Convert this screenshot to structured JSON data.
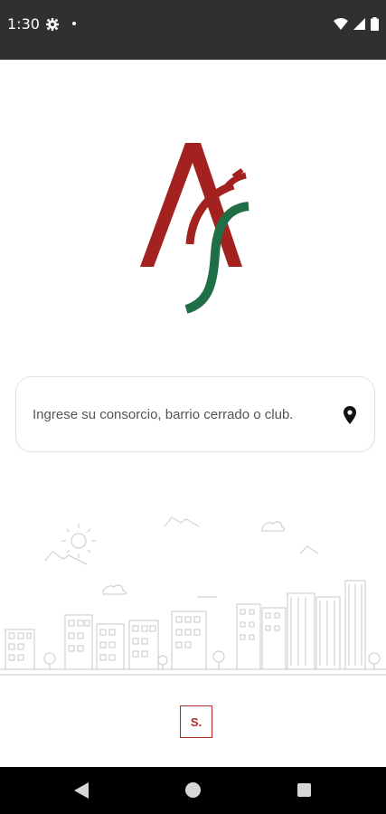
{
  "status_bar": {
    "time": "1:30",
    "icons": [
      "settings-icon",
      "notification-dot",
      "wifi-icon",
      "cell-signal-icon",
      "battery-icon"
    ]
  },
  "logo": {
    "name": "asf-logo",
    "colors": {
      "red": "#a3221f",
      "green": "#1f6e45"
    }
  },
  "search": {
    "placeholder": "Ingrese su consorcio, barrio cerrado o club.",
    "icon": "location-pin-icon"
  },
  "illustration": {
    "name": "city-skyline-illustration"
  },
  "footer": {
    "badge_label": "S.",
    "badge_color": "#b32a2a"
  },
  "nav_bar": {
    "buttons": [
      "back-icon",
      "home-icon",
      "recents-icon"
    ]
  }
}
